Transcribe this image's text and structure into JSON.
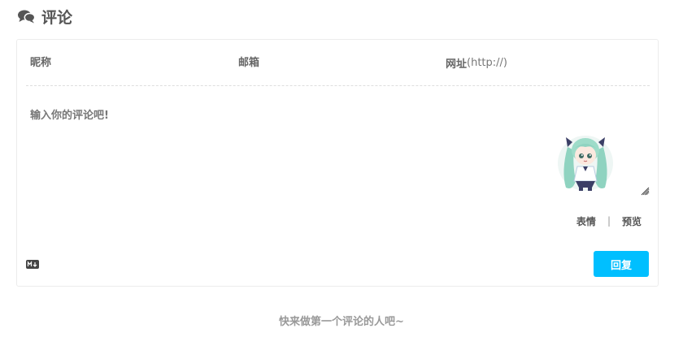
{
  "section": {
    "title": "评论",
    "icon": "comments-icon"
  },
  "form": {
    "nickname_placeholder": "昵称",
    "email_placeholder": "邮箱",
    "website_label": "网址",
    "website_hint": "(http://)",
    "comment_placeholder": "输入你的评论吧!",
    "emoji_label": "表情",
    "separator": "|",
    "preview_label": "预览",
    "reply_label": "回复",
    "markdown_icon": "markdown-icon",
    "mascot_icon": "anime-mascot-avatar"
  },
  "empty_state": {
    "message": "快来做第一个评论的人吧~"
  },
  "colors": {
    "accent": "#00bfff",
    "text": "#555555",
    "muted": "#999999",
    "border": "#ececec"
  }
}
